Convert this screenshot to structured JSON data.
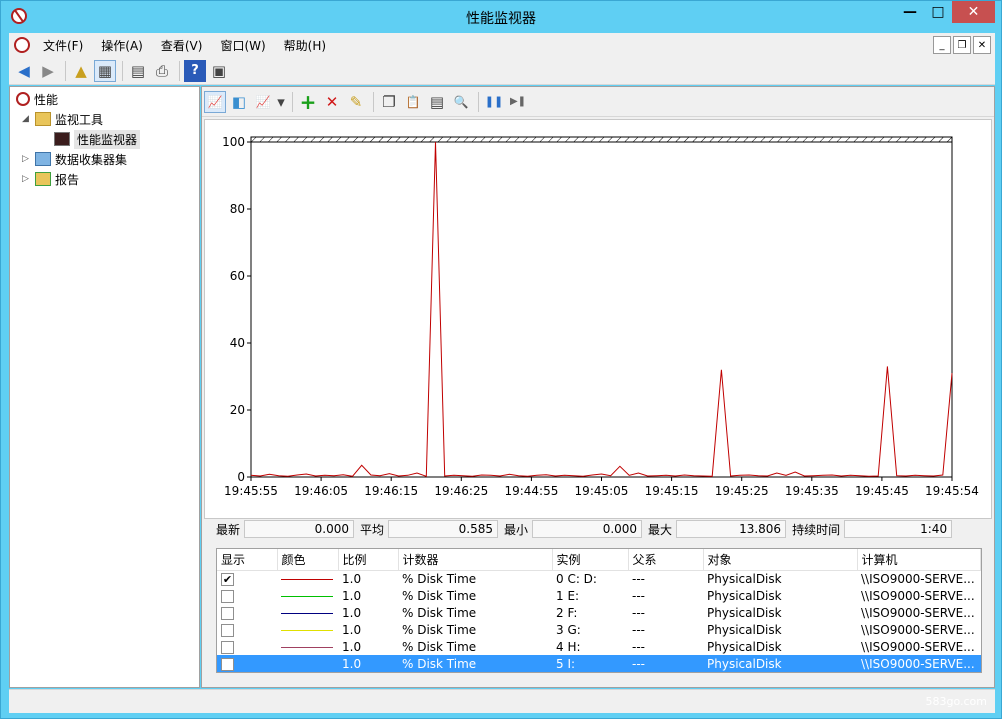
{
  "window": {
    "title": "性能监视器"
  },
  "menu": {
    "items": [
      "文件(F)",
      "操作(A)",
      "查看(V)",
      "窗口(W)",
      "帮助(H)"
    ]
  },
  "tree": {
    "root": "性能",
    "monitoring_tools": "监视工具",
    "performance_monitor": "性能监视器",
    "data_collector_sets": "数据收集器集",
    "reports": "报告"
  },
  "chart_data": {
    "type": "line",
    "ylim": [
      0,
      100
    ],
    "yticks": [
      0,
      20,
      40,
      60,
      80,
      100
    ],
    "xtick_labels": [
      "19:45:55",
      "19:46:05",
      "19:46:15",
      "19:46:25",
      "19:44:55",
      "19:45:05",
      "19:45:15",
      "19:45:25",
      "19:45:35",
      "19:45:45",
      "19:45:54"
    ],
    "series": [
      {
        "name": "% Disk Time",
        "color": "#c00000",
        "values": [
          0.5,
          0.3,
          0.8,
          0.4,
          0.2,
          0.6,
          0.9,
          0.3,
          0.5,
          0.4,
          0.7,
          0.2,
          3.5,
          0.6,
          0.4,
          1.0,
          0.3,
          0.5,
          1.2,
          0.2,
          100,
          0.3,
          0.5,
          0.4,
          0.2,
          0.6,
          0.5,
          0.3,
          0.8,
          0.4,
          0.2,
          0.5,
          0.7,
          0.3,
          0.5,
          0.4,
          0.2,
          0.6,
          0.9,
          0.4,
          3.2,
          0.5,
          1.2,
          0.3,
          0.4,
          0.5,
          0.3,
          0.6,
          0.4,
          0.3,
          0.2,
          32,
          0.3,
          0.5,
          0.6,
          0.4,
          0.3,
          1.2,
          0.5,
          1.5,
          0.3,
          0.4,
          0.5,
          0.6,
          0.3,
          0.5,
          0.4,
          0.2,
          0.3,
          33,
          0.4,
          0.3,
          0.5,
          0.4,
          0.3,
          0.6,
          31
        ]
      }
    ]
  },
  "stats": {
    "last_label": "最新",
    "last_value": "0.000",
    "avg_label": "平均",
    "avg_value": "0.585",
    "min_label": "最小",
    "min_value": "0.000",
    "max_label": "最大",
    "max_value": "13.806",
    "duration_label": "持续时间",
    "duration_value": "1:40"
  },
  "legend": {
    "headers": [
      "显示",
      "颜色",
      "比例",
      "计数器",
      "实例",
      "父系",
      "对象",
      "计算机"
    ],
    "rows": [
      {
        "checked": true,
        "color": "#c00000",
        "scale": "1.0",
        "counter": "% Disk Time",
        "instance": "0 C: D:",
        "parent": "---",
        "object": "PhysicalDisk",
        "computer": "\\\\ISO9000-SERVE..."
      },
      {
        "checked": false,
        "color": "#00c000",
        "scale": "1.0",
        "counter": "% Disk Time",
        "instance": "1 E:",
        "parent": "---",
        "object": "PhysicalDisk",
        "computer": "\\\\ISO9000-SERVE..."
      },
      {
        "checked": false,
        "color": "#000080",
        "scale": "1.0",
        "counter": "% Disk Time",
        "instance": "2 F:",
        "parent": "---",
        "object": "PhysicalDisk",
        "computer": "\\\\ISO9000-SERVE..."
      },
      {
        "checked": false,
        "color": "#e0e000",
        "scale": "1.0",
        "counter": "% Disk Time",
        "instance": "3 G:",
        "parent": "---",
        "object": "PhysicalDisk",
        "computer": "\\\\ISO9000-SERVE..."
      },
      {
        "checked": false,
        "color": "#a04060",
        "scale": "1.0",
        "counter": "% Disk Time",
        "instance": "4 H:",
        "parent": "---",
        "object": "PhysicalDisk",
        "computer": "\\\\ISO9000-SERVE..."
      },
      {
        "checked": false,
        "color": "#3399ff",
        "scale": "1.0",
        "counter": "% Disk Time",
        "instance": "5 I:",
        "parent": "---",
        "object": "PhysicalDisk",
        "computer": "\\\\ISO9000-SERVE...",
        "selected": true
      }
    ]
  },
  "watermark": "583go.com",
  "icons": {
    "back": "◀",
    "forward": "▶",
    "folder_up": "▲",
    "show_tree": "▦",
    "properties": "▤",
    "print": "⎙",
    "help": "?",
    "mmc": "▣",
    "view_graph": "📈",
    "freeze": "◧",
    "change_type": "▾",
    "add": "+",
    "delete": "✕",
    "highlight": "✎",
    "copy": "❐",
    "paste": "📋",
    "props2": "▤",
    "zoom": "🔍",
    "pause": "❚❚",
    "update": "▶❚"
  }
}
